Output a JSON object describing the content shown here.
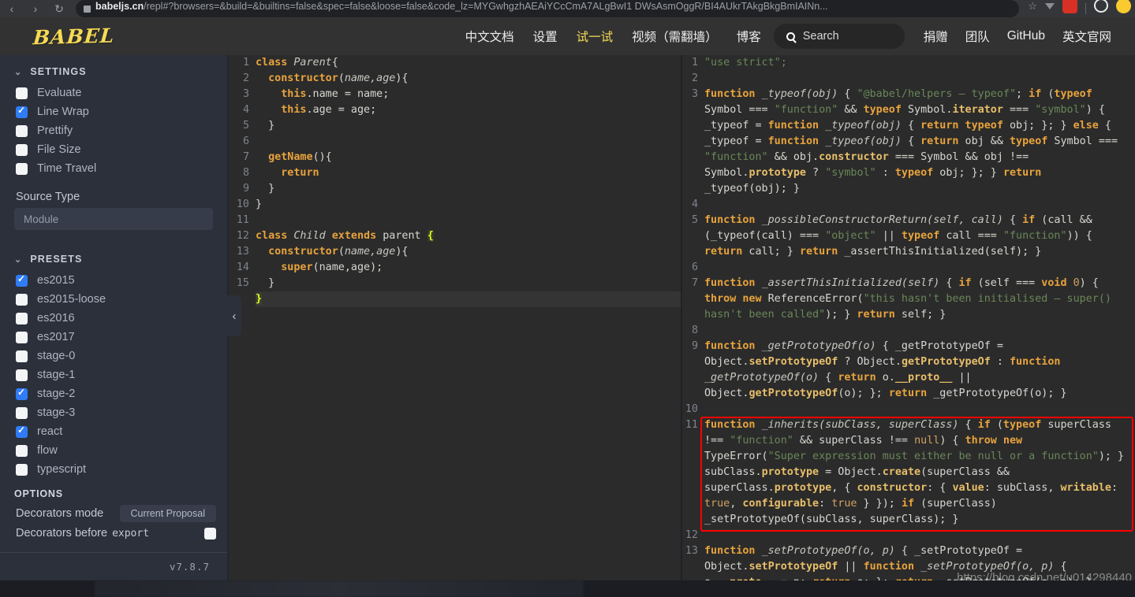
{
  "browser": {
    "back_icon": "‹",
    "forward_icon": "›",
    "reload_icon": "↻",
    "url_host": "babeljs.cn",
    "url_path": "/repl#?browsers=&build=&builtins=false&spec=false&loose=false&code_lz=MYGwhgzhAEAiYCcCmA7ALgBwI1 DWsAsmOggR/BI4AUkrTAkgBkgBmIAINn...",
    "star_icon": "☆",
    "triangle_icon": "triangle-down-icon",
    "extension_icon": "extension-icon",
    "profile_ring_icon": "profile-ring-icon",
    "avatar_icon": "avatar-icon"
  },
  "header": {
    "logo": "BABEL",
    "nav_center": [
      {
        "label": "中文文档",
        "active": false
      },
      {
        "label": "设置",
        "active": false
      },
      {
        "label": "试一试",
        "active": true
      },
      {
        "label": "视频（需翻墙）",
        "active": false
      },
      {
        "label": "博客",
        "active": false
      }
    ],
    "search": {
      "placeholder": "Search",
      "icon": "search-icon"
    },
    "nav_right": [
      {
        "label": "捐赠"
      },
      {
        "label": "团队"
      },
      {
        "label": "GitHub"
      },
      {
        "label": "英文官网"
      }
    ]
  },
  "sidebar": {
    "settings": {
      "title": "SETTINGS",
      "chevron": "⌄",
      "items": [
        {
          "label": "Evaluate",
          "checked": false
        },
        {
          "label": "Line Wrap",
          "checked": true
        },
        {
          "label": "Prettify",
          "checked": false
        },
        {
          "label": "File Size",
          "checked": false
        },
        {
          "label": "Time Travel",
          "checked": false
        }
      ],
      "source_type_label": "Source Type",
      "source_type_value": "Module"
    },
    "presets": {
      "title": "PRESETS",
      "chevron": "⌄",
      "items": [
        {
          "label": "es2015",
          "checked": true
        },
        {
          "label": "es2015-loose",
          "checked": false
        },
        {
          "label": "es2016",
          "checked": false
        },
        {
          "label": "es2017",
          "checked": false
        },
        {
          "label": "stage-0",
          "checked": false
        },
        {
          "label": "stage-1",
          "checked": false
        },
        {
          "label": "stage-2",
          "checked": true
        },
        {
          "label": "stage-3",
          "checked": false
        },
        {
          "label": "react",
          "checked": true
        },
        {
          "label": "flow",
          "checked": false
        },
        {
          "label": "typescript",
          "checked": false
        }
      ]
    },
    "options": {
      "title": "OPTIONS",
      "decorators_mode_label": "Decorators mode",
      "decorators_mode_value": "Current Proposal",
      "decorators_before_label": "Decorators before",
      "decorators_before_mono": "export",
      "decorators_before_checked": false
    },
    "version": "v7.8.7",
    "collapse_icon": "‹"
  },
  "input_editor": {
    "lines": [
      {
        "n": "1",
        "tokens": [
          {
            "t": "class ",
            "c": "kw"
          },
          {
            "t": "Parent",
            "c": "ital"
          },
          {
            "t": "{",
            "c": "plain"
          }
        ]
      },
      {
        "n": "2",
        "tokens": [
          {
            "t": "  ",
            "c": "plain"
          },
          {
            "t": "constructor",
            "c": "fn"
          },
          {
            "t": "(",
            "c": "plain"
          },
          {
            "t": "name,age",
            "c": "ital"
          },
          {
            "t": "){",
            "c": "plain"
          }
        ]
      },
      {
        "n": "3",
        "tokens": [
          {
            "t": "    ",
            "c": "plain"
          },
          {
            "t": "this",
            "c": "kw"
          },
          {
            "t": ".name = name;",
            "c": "plain"
          }
        ]
      },
      {
        "n": "4",
        "tokens": [
          {
            "t": "    ",
            "c": "plain"
          },
          {
            "t": "this",
            "c": "kw"
          },
          {
            "t": ".age = age;",
            "c": "plain"
          }
        ]
      },
      {
        "n": "5",
        "tokens": [
          {
            "t": "  }",
            "c": "plain"
          }
        ]
      },
      {
        "n": "6",
        "tokens": [
          {
            "t": "",
            "c": "plain"
          }
        ]
      },
      {
        "n": "7",
        "tokens": [
          {
            "t": "  ",
            "c": "plain"
          },
          {
            "t": "getName",
            "c": "fn"
          },
          {
            "t": "(){",
            "c": "plain"
          }
        ]
      },
      {
        "n": "8",
        "tokens": [
          {
            "t": "    ",
            "c": "plain"
          },
          {
            "t": "return",
            "c": "kw"
          }
        ]
      },
      {
        "n": "9",
        "tokens": [
          {
            "t": "  }",
            "c": "plain"
          }
        ]
      },
      {
        "n": "10",
        "tokens": [
          {
            "t": "}",
            "c": "plain"
          }
        ]
      },
      {
        "n": "11",
        "tokens": [
          {
            "t": "",
            "c": "plain"
          }
        ]
      },
      {
        "n": "12",
        "tokens": [
          {
            "t": "class ",
            "c": "kw"
          },
          {
            "t": "Child ",
            "c": "ital"
          },
          {
            "t": "extends",
            "c": "kw"
          },
          {
            "t": " parent ",
            "c": "plain"
          },
          {
            "t": "{",
            "c": "brk"
          }
        ]
      },
      {
        "n": "13",
        "tokens": [
          {
            "t": "  ",
            "c": "plain"
          },
          {
            "t": "constructor",
            "c": "fn"
          },
          {
            "t": "(",
            "c": "plain"
          },
          {
            "t": "name,age",
            "c": "ital"
          },
          {
            "t": "){",
            "c": "plain"
          }
        ]
      },
      {
        "n": "14",
        "tokens": [
          {
            "t": "    ",
            "c": "plain"
          },
          {
            "t": "super",
            "c": "fn"
          },
          {
            "t": "(name,age);",
            "c": "plain"
          }
        ]
      },
      {
        "n": "15",
        "tokens": [
          {
            "t": "  }",
            "c": "plain"
          }
        ]
      },
      {
        "n": "",
        "selected": true,
        "tokens": [
          {
            "t": "}",
            "c": "brk"
          }
        ]
      }
    ]
  },
  "output_editor": {
    "lines": [
      {
        "n": "1",
        "tokens": [
          {
            "t": "\"use strict\";",
            "c": "str"
          }
        ]
      },
      {
        "n": "2",
        "tokens": [
          {
            "t": "",
            "c": "plain"
          }
        ]
      },
      {
        "n": "3",
        "tokens": [
          {
            "t": "function ",
            "c": "kw"
          },
          {
            "t": "_typeof(obj)",
            "c": "ital"
          },
          {
            "t": " { ",
            "c": "plain"
          },
          {
            "t": "\"@babel/helpers – typeof\"",
            "c": "str"
          },
          {
            "t": "; ",
            "c": "plain"
          },
          {
            "t": "if",
            "c": "kw"
          },
          {
            "t": " (",
            "c": "plain"
          },
          {
            "t": "typeof",
            "c": "kw"
          },
          {
            "t": " Symbol === ",
            "c": "plain"
          },
          {
            "t": "\"function\"",
            "c": "str"
          },
          {
            "t": " && ",
            "c": "plain"
          },
          {
            "t": "typeof",
            "c": "kw"
          },
          {
            "t": " Symbol.",
            "c": "plain"
          },
          {
            "t": "iterator",
            "c": "prop"
          },
          {
            "t": " === ",
            "c": "plain"
          },
          {
            "t": "\"symbol\"",
            "c": "str"
          },
          {
            "t": ") { _typeof = ",
            "c": "plain"
          },
          {
            "t": "function ",
            "c": "kw"
          },
          {
            "t": "_typeof(obj)",
            "c": "ital"
          },
          {
            "t": " { ",
            "c": "plain"
          },
          {
            "t": "return typeof",
            "c": "kw"
          },
          {
            "t": " obj; }; } ",
            "c": "plain"
          },
          {
            "t": "else",
            "c": "kw"
          },
          {
            "t": " { _typeof = ",
            "c": "plain"
          },
          {
            "t": "function ",
            "c": "kw"
          },
          {
            "t": "_typeof(obj)",
            "c": "ital"
          },
          {
            "t": " { ",
            "c": "plain"
          },
          {
            "t": "return",
            "c": "kw"
          },
          {
            "t": " obj && ",
            "c": "plain"
          },
          {
            "t": "typeof",
            "c": "kw"
          },
          {
            "t": " Symbol === ",
            "c": "plain"
          },
          {
            "t": "\"function\"",
            "c": "str"
          },
          {
            "t": " && obj.",
            "c": "plain"
          },
          {
            "t": "constructor",
            "c": "prop"
          },
          {
            "t": " === Symbol && obj !== Symbol.",
            "c": "plain"
          },
          {
            "t": "prototype",
            "c": "prop"
          },
          {
            "t": " ? ",
            "c": "plain"
          },
          {
            "t": "\"symbol\"",
            "c": "str"
          },
          {
            "t": " : ",
            "c": "plain"
          },
          {
            "t": "typeof",
            "c": "kw"
          },
          {
            "t": " obj; }; } ",
            "c": "plain"
          },
          {
            "t": "return",
            "c": "kw"
          },
          {
            "t": " _typeof(obj); }",
            "c": "plain"
          }
        ]
      },
      {
        "n": "4",
        "tokens": [
          {
            "t": "",
            "c": "plain"
          }
        ]
      },
      {
        "n": "5",
        "tokens": [
          {
            "t": "function ",
            "c": "kw"
          },
          {
            "t": "_possibleConstructorReturn(self, call)",
            "c": "ital"
          },
          {
            "t": " { ",
            "c": "plain"
          },
          {
            "t": "if",
            "c": "kw"
          },
          {
            "t": " (call && (_typeof(call) === ",
            "c": "plain"
          },
          {
            "t": "\"object\"",
            "c": "str"
          },
          {
            "t": " || ",
            "c": "plain"
          },
          {
            "t": "typeof",
            "c": "kw"
          },
          {
            "t": " call === ",
            "c": "plain"
          },
          {
            "t": "\"function\"",
            "c": "str"
          },
          {
            "t": ")) { ",
            "c": "plain"
          },
          {
            "t": "return",
            "c": "kw"
          },
          {
            "t": " call; } ",
            "c": "plain"
          },
          {
            "t": "return",
            "c": "kw"
          },
          {
            "t": " _assertThisInitialized(self); }",
            "c": "plain"
          }
        ]
      },
      {
        "n": "6",
        "tokens": [
          {
            "t": "",
            "c": "plain"
          }
        ]
      },
      {
        "n": "7",
        "tokens": [
          {
            "t": "function ",
            "c": "kw"
          },
          {
            "t": "_assertThisInitialized(self)",
            "c": "ital"
          },
          {
            "t": " { ",
            "c": "plain"
          },
          {
            "t": "if",
            "c": "kw"
          },
          {
            "t": " (self === ",
            "c": "plain"
          },
          {
            "t": "void",
            "c": "kw"
          },
          {
            "t": " ",
            "c": "plain"
          },
          {
            "t": "0",
            "c": "num"
          },
          {
            "t": ") { ",
            "c": "plain"
          },
          {
            "t": "throw new",
            "c": "kw"
          },
          {
            "t": " ReferenceError(",
            "c": "plain"
          },
          {
            "t": "\"this hasn't been initialised – super() hasn't been called\"",
            "c": "str"
          },
          {
            "t": "); } ",
            "c": "plain"
          },
          {
            "t": "return",
            "c": "kw"
          },
          {
            "t": " self; }",
            "c": "plain"
          }
        ]
      },
      {
        "n": "8",
        "tokens": [
          {
            "t": "",
            "c": "plain"
          }
        ]
      },
      {
        "n": "9",
        "tokens": [
          {
            "t": "function ",
            "c": "kw"
          },
          {
            "t": "_getPrototypeOf(o)",
            "c": "ital"
          },
          {
            "t": " { _getPrototypeOf = Object.",
            "c": "plain"
          },
          {
            "t": "setPrototypeOf",
            "c": "prop"
          },
          {
            "t": " ? Object.",
            "c": "plain"
          },
          {
            "t": "getPrototypeOf",
            "c": "prop"
          },
          {
            "t": " : ",
            "c": "plain"
          },
          {
            "t": "function ",
            "c": "kw"
          },
          {
            "t": "_getPrototypeOf(o)",
            "c": "ital"
          },
          {
            "t": " { ",
            "c": "plain"
          },
          {
            "t": "return",
            "c": "kw"
          },
          {
            "t": " o.",
            "c": "plain"
          },
          {
            "t": "__proto__",
            "c": "prop"
          },
          {
            "t": " || Object.",
            "c": "plain"
          },
          {
            "t": "getPrototypeOf",
            "c": "prop"
          },
          {
            "t": "(o); }; ",
            "c": "plain"
          },
          {
            "t": "return",
            "c": "kw"
          },
          {
            "t": " _getPrototypeOf(o); }",
            "c": "plain"
          }
        ]
      },
      {
        "n": "10",
        "tokens": [
          {
            "t": "",
            "c": "plain"
          }
        ]
      },
      {
        "n": "11",
        "highlighted": true,
        "tokens": [
          {
            "t": "function ",
            "c": "kw"
          },
          {
            "t": "_inherits(subClass, superClass)",
            "c": "ital"
          },
          {
            "t": " { ",
            "c": "plain"
          },
          {
            "t": "if",
            "c": "kw"
          },
          {
            "t": " (",
            "c": "plain"
          },
          {
            "t": "typeof",
            "c": "kw"
          },
          {
            "t": " superClass !== ",
            "c": "plain"
          },
          {
            "t": "\"function\"",
            "c": "str"
          },
          {
            "t": " && superClass !== ",
            "c": "plain"
          },
          {
            "t": "null",
            "c": "num"
          },
          {
            "t": ") { ",
            "c": "plain"
          },
          {
            "t": "throw new",
            "c": "kw"
          },
          {
            "t": " TypeError(",
            "c": "plain"
          },
          {
            "t": "\"Super expression must either be null or a function\"",
            "c": "str"
          },
          {
            "t": "); } subClass.",
            "c": "plain"
          },
          {
            "t": "prototype",
            "c": "prop"
          },
          {
            "t": " = Object.",
            "c": "plain"
          },
          {
            "t": "create",
            "c": "prop"
          },
          {
            "t": "(superClass && superClass.",
            "c": "plain"
          },
          {
            "t": "prototype",
            "c": "prop"
          },
          {
            "t": ", { ",
            "c": "plain"
          },
          {
            "t": "constructor",
            "c": "prop"
          },
          {
            "t": ": { ",
            "c": "plain"
          },
          {
            "t": "value",
            "c": "prop"
          },
          {
            "t": ": subClass, ",
            "c": "plain"
          },
          {
            "t": "writable",
            "c": "prop"
          },
          {
            "t": ": ",
            "c": "plain"
          },
          {
            "t": "true",
            "c": "num"
          },
          {
            "t": ", ",
            "c": "plain"
          },
          {
            "t": "configurable",
            "c": "prop"
          },
          {
            "t": ": ",
            "c": "plain"
          },
          {
            "t": "true",
            "c": "num"
          },
          {
            "t": " } }); ",
            "c": "plain"
          },
          {
            "t": "if",
            "c": "kw"
          },
          {
            "t": " (superClass) _setPrototypeOf(subClass, superClass); }",
            "c": "plain"
          }
        ]
      },
      {
        "n": "12",
        "tokens": [
          {
            "t": "",
            "c": "plain"
          }
        ]
      },
      {
        "n": "13",
        "tokens": [
          {
            "t": "function ",
            "c": "kw"
          },
          {
            "t": "_setPrototypeOf(o, p)",
            "c": "ital"
          },
          {
            "t": " { _setPrototypeOf = Object.",
            "c": "plain"
          },
          {
            "t": "setPrototypeOf",
            "c": "prop"
          },
          {
            "t": " || ",
            "c": "plain"
          },
          {
            "t": "function ",
            "c": "kw"
          },
          {
            "t": "_setPrototypeOf(o, p)",
            "c": "ital"
          },
          {
            "t": " { o.",
            "c": "plain"
          },
          {
            "t": "__proto__",
            "c": "prop"
          },
          {
            "t": " = p; ",
            "c": "plain"
          },
          {
            "t": "return",
            "c": "kw"
          },
          {
            "t": " o; }; ",
            "c": "plain"
          },
          {
            "t": "return",
            "c": "kw"
          },
          {
            "t": " _setPrototypeOf(o, p); }",
            "c": "plain"
          }
        ]
      }
    ]
  },
  "watermark": "https://blog.csdn.net/u014298440",
  "colors": {
    "accent_yellow": "#f5da55",
    "checkbox_on": "#2f7cf6",
    "highlight_box": "#ff0000",
    "editor_bg": "#2b2b2b",
    "sidebar_bg": "#2b303b",
    "header_bg": "#323232"
  }
}
